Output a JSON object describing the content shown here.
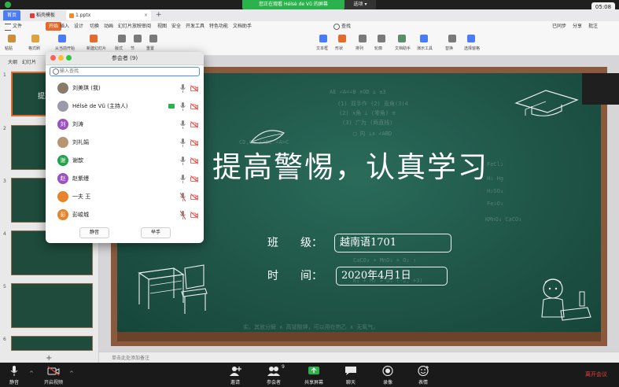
{
  "share_banner": {
    "text": "您正在观看 Hélsè de Vũ 的屏幕",
    "options": "选项",
    "clock": "05:08"
  },
  "tabs": {
    "home": "首页",
    "template": "稻壳模板",
    "document": "1.pptx"
  },
  "ribbon": {
    "menu": [
      "文件",
      "开始",
      "插入",
      "设计",
      "切换",
      "动画",
      "幻灯片放映",
      "审阅",
      "视图",
      "安全",
      "开发工具",
      "特色功能",
      "文档助手"
    ],
    "active_menu": "开始",
    "search": "查找",
    "right_items": [
      "已同步",
      "分享",
      "批注"
    ],
    "tools": [
      "粘贴",
      "格式刷",
      "从当前开始",
      "新建幻灯片",
      "版式",
      "节",
      "重置",
      "文本框",
      "形状",
      "排列",
      "轮廓",
      "文档助手",
      "演示工具",
      "替换",
      "选择窗格"
    ]
  },
  "slide_panel": {
    "tabs": [
      "大纲",
      "幻灯片"
    ],
    "thumbs": [
      {
        "num": "1",
        "title": "提高警惕"
      },
      {
        "num": "2",
        "title": "目录"
      },
      {
        "num": "3",
        "title": ""
      },
      {
        "num": "4",
        "title": ""
      },
      {
        "num": "5",
        "title": ""
      },
      {
        "num": "6",
        "title": ""
      }
    ],
    "add": "+"
  },
  "slide": {
    "title": "提高警惕，认真学习",
    "class_label": "班　　级：",
    "class_value": "越南语1701",
    "time_label": "时　　间：",
    "time_value": "2020年4月1日"
  },
  "notes": "单击此处添加备注",
  "participants": {
    "title": "参会者 (9)",
    "search_placeholder": "输入查找",
    "members": [
      {
        "name": "刘美琪 (我)",
        "avatar": "",
        "color": "#8a7a6a",
        "mic": "on",
        "cam": "off",
        "sharing": false
      },
      {
        "name": "Hélsè de Vũ (主持人)",
        "avatar": "",
        "color": "#9a9aa8",
        "mic": "on",
        "cam": "off",
        "sharing": true
      },
      {
        "name": "刘涛",
        "avatar": "刘",
        "color": "#9b51c2",
        "mic": "on",
        "cam": "off",
        "sharing": false
      },
      {
        "name": "刘礼娟",
        "avatar": "",
        "color": "#b89572",
        "mic": "on",
        "cam": "off",
        "sharing": false
      },
      {
        "name": "谢歆",
        "avatar": "谢",
        "color": "#22a34a",
        "mic": "on",
        "cam": "off",
        "sharing": false
      },
      {
        "name": "赵紫缦",
        "avatar": "赵",
        "color": "#9b51c2",
        "mic": "on",
        "cam": "off",
        "sharing": false
      },
      {
        "name": "一夫 王",
        "avatar": "",
        "color": "#e6832b",
        "mic": "off",
        "cam": "off",
        "sharing": false
      },
      {
        "name": "彭峻城",
        "avatar": "彭",
        "color": "#e6832b",
        "mic": "off",
        "cam": "off",
        "sharing": false
      }
    ],
    "mute_all": "静音",
    "raise_hand": "举手"
  },
  "toolbar": {
    "mute": "静音",
    "video": "开启视频",
    "invite": "邀请",
    "participants": "参会者",
    "participants_count": "9",
    "share": "共享屏幕",
    "chat": "聊天",
    "record": "录像",
    "reactions": "表情",
    "end": "离开会议"
  }
}
